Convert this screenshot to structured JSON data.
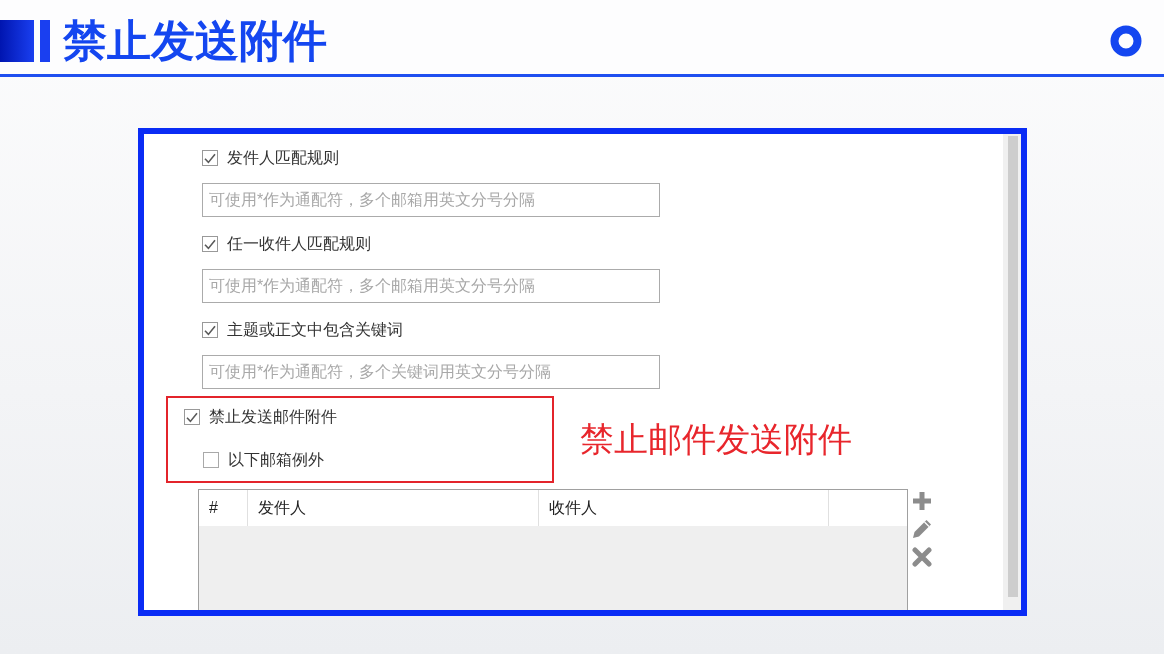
{
  "header": {
    "title": "禁止发送附件"
  },
  "dialog": {
    "rules": [
      {
        "label": "发件人匹配规则",
        "checked": true,
        "placeholder": "可使用*作为通配符，多个邮箱用英文分号分隔"
      },
      {
        "label": "任一收件人匹配规则",
        "checked": true,
        "placeholder": "可使用*作为通配符，多个邮箱用英文分号分隔"
      },
      {
        "label": "主题或正文中包含关键词",
        "checked": true,
        "placeholder": "可使用*作为通配符，多个关键词用英文分号分隔"
      }
    ],
    "block_attachments": {
      "label": "禁止发送邮件附件",
      "checked": true
    },
    "exceptions": {
      "label": "以下邮箱例外",
      "checked": false
    },
    "exception_table": {
      "columns": [
        "#",
        "发件人",
        "收件人"
      ]
    }
  },
  "callout": {
    "text": "禁止邮件发送附件"
  }
}
